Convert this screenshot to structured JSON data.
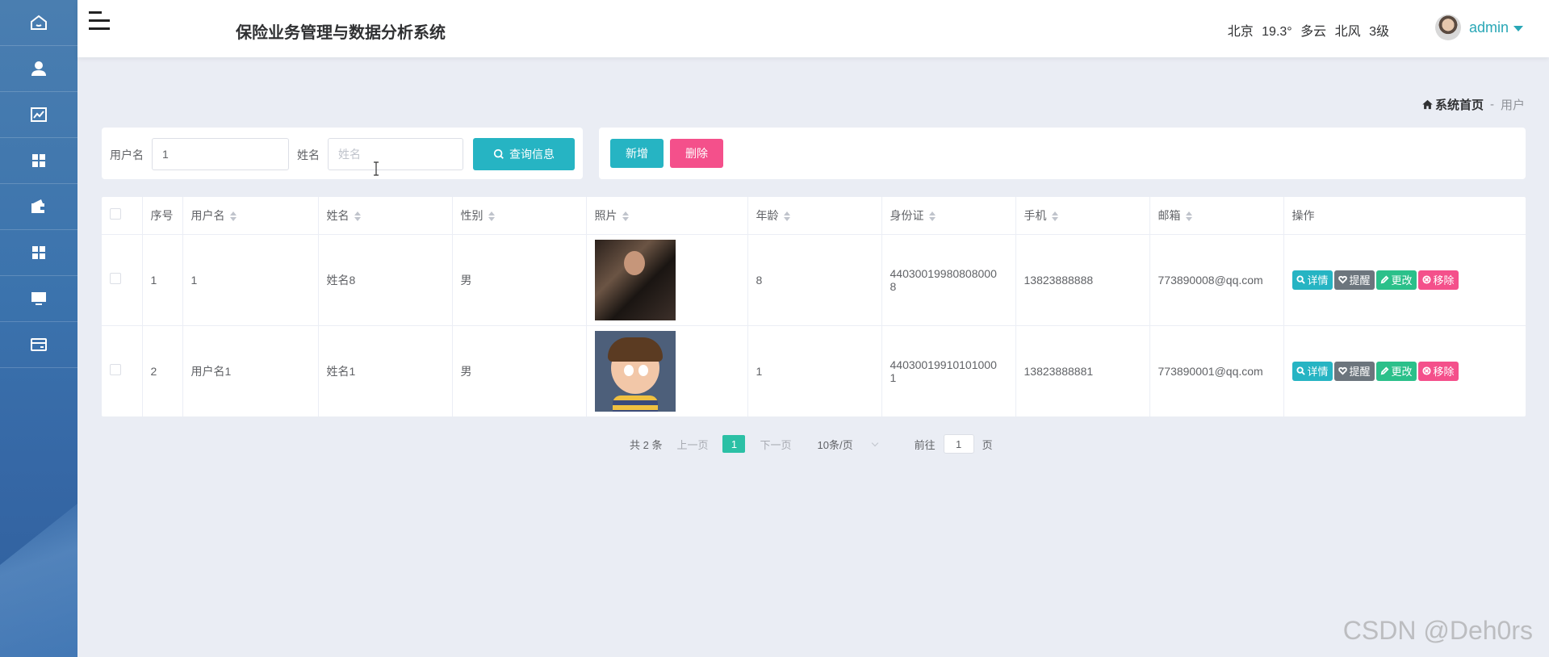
{
  "header": {
    "title": "保险业务管理与数据分析系统",
    "weather": {
      "city": "北京",
      "temp": "19.3°",
      "condition": "多云",
      "wind": "北风",
      "level": "3级"
    },
    "user": "admin"
  },
  "sidebar": {
    "items": [
      {
        "icon": "home-icon"
      },
      {
        "icon": "user-icon"
      },
      {
        "icon": "chart-icon"
      },
      {
        "icon": "grid-icon"
      },
      {
        "icon": "wallet-icon"
      },
      {
        "icon": "grid-icon"
      },
      {
        "icon": "monitor-icon"
      },
      {
        "icon": "card-icon"
      }
    ]
  },
  "breadcrumb": {
    "home": "系统首页",
    "separator": "-",
    "current": "用户"
  },
  "search": {
    "username_label": "用户名",
    "username_value": "1",
    "name_label": "姓名",
    "name_placeholder": "姓名",
    "search_button": "查询信息"
  },
  "actions": {
    "add": "新增",
    "delete": "删除"
  },
  "table": {
    "columns": [
      "序号",
      "用户名",
      "姓名",
      "性别",
      "照片",
      "年龄",
      "身份证",
      "手机",
      "邮箱",
      "操作"
    ],
    "rows": [
      {
        "index": "1",
        "username": "1",
        "name": "姓名8",
        "gender": "男",
        "photo": "photo-young-man",
        "age": "8",
        "id_card_line1": "44030019980808000",
        "id_card_line2": "8",
        "phone": "13823888888",
        "email": "773890008@qq.com"
      },
      {
        "index": "2",
        "username": "用户名1",
        "name": "姓名1",
        "gender": "男",
        "photo": "photo-cartoon-boy",
        "age": "1",
        "id_card_line1": "44030019910101000",
        "id_card_line2": "1",
        "phone": "13823888881",
        "email": "773890001@qq.com"
      }
    ],
    "ops": {
      "detail": "详情",
      "remind": "提醒",
      "edit": "更改",
      "remove": "移除"
    }
  },
  "pagination": {
    "total": "共 2 条",
    "prev": "上一页",
    "current": "1",
    "next": "下一页",
    "page_size": "10条/页",
    "goto_label": "前往",
    "goto_value": "1",
    "page_suffix": "页"
  },
  "watermark": "CSDN @Deh0rs",
  "colors": {
    "accent": "#26b4c3",
    "danger": "#f4508b",
    "success": "#2bc08a",
    "gray": "#6c757d"
  }
}
